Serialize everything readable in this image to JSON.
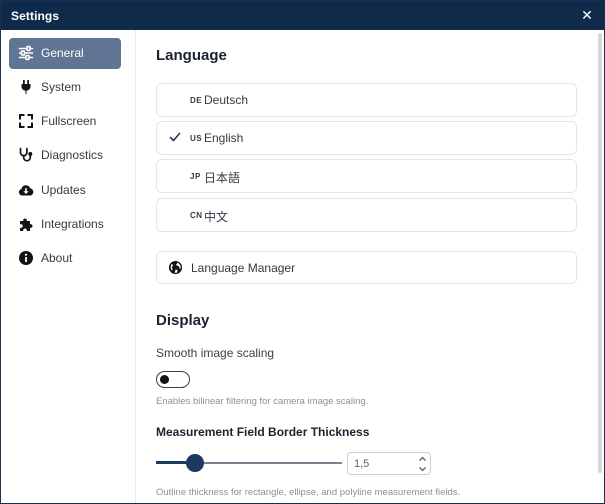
{
  "window": {
    "title": "Settings",
    "close_glyph": "✕"
  },
  "sidebar": {
    "items": [
      {
        "label": "General",
        "icon": "sliders-icon",
        "active": true
      },
      {
        "label": "System",
        "icon": "plug-icon"
      },
      {
        "label": "Fullscreen",
        "icon": "fullscreen-icon"
      },
      {
        "label": "Diagnostics",
        "icon": "stethoscope-icon"
      },
      {
        "label": "Updates",
        "icon": "cloud-download-icon"
      },
      {
        "label": "Integrations",
        "icon": "puzzle-icon"
      },
      {
        "label": "About",
        "icon": "info-icon"
      }
    ]
  },
  "language": {
    "heading": "Language",
    "options": [
      {
        "code": "DE",
        "name": "Deutsch",
        "selected": false
      },
      {
        "code": "US",
        "name": "English",
        "selected": true
      },
      {
        "code": "JP",
        "name": "日本語",
        "selected": false
      },
      {
        "code": "CN",
        "name": "中文",
        "selected": false
      }
    ],
    "manager_label": "Language Manager"
  },
  "display": {
    "heading": "Display",
    "smooth_scaling": {
      "label": "Smooth image scaling",
      "enabled": false,
      "hint": "Enables bilinear filtering for camera image scaling."
    },
    "border_thickness": {
      "label": "Measurement Field Border Thickness",
      "value": "1,5",
      "slider_fraction": 0.21,
      "hint": "Outline thickness for rectangle, ellipse, and polyline measurement fields."
    }
  },
  "colors": {
    "titlebar": "#102a4c",
    "active_nav": "#5f7593",
    "accent": "#193a63"
  }
}
